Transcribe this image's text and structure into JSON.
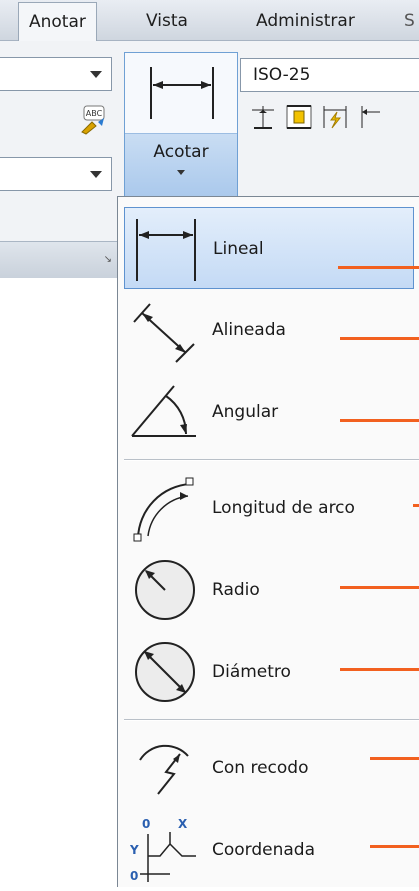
{
  "tabs": [
    {
      "label": "Anotar",
      "active": true
    },
    {
      "label": "Vista",
      "active": false
    },
    {
      "label": "Administrar",
      "active": false
    }
  ],
  "ribbon": {
    "dimension_button": {
      "label": "Acotar",
      "icon": "linear-dimension-icon"
    },
    "dimension_style": {
      "value": "ISO-25"
    },
    "tools": [
      {
        "icon": "continue-dimension-icon"
      },
      {
        "icon": "dimension-space-icon"
      },
      {
        "icon": "dimension-break-icon"
      },
      {
        "icon": "baseline-dimension-icon"
      }
    ],
    "check_spelling_icon": "check-spelling-icon",
    "panel_launcher_icon": "panel-launcher-icon"
  },
  "menu": {
    "items": [
      {
        "label": "Lineal",
        "icon": "linear-dimension-icon",
        "selected": true
      },
      {
        "label": "Alineada",
        "icon": "aligned-dimension-icon"
      },
      {
        "label": "Angular",
        "icon": "angular-dimension-icon"
      },
      {
        "label": "Longitud de arco",
        "icon": "arc-length-icon"
      },
      {
        "label": "Radio",
        "icon": "radius-dimension-icon"
      },
      {
        "label": "Diámetro",
        "icon": "diameter-dimension-icon"
      },
      {
        "label": "Con recodo",
        "icon": "jogged-dimension-icon"
      },
      {
        "label": "Coordenada",
        "icon": "ordinate-dimension-icon"
      }
    ],
    "ordinate_icon_text": {
      "x": "X",
      "y": "Y",
      "zero": "0"
    }
  },
  "colors": {
    "callout": "#f2601f",
    "selection": "#c4daf5",
    "selection_border": "#5e92cf"
  }
}
